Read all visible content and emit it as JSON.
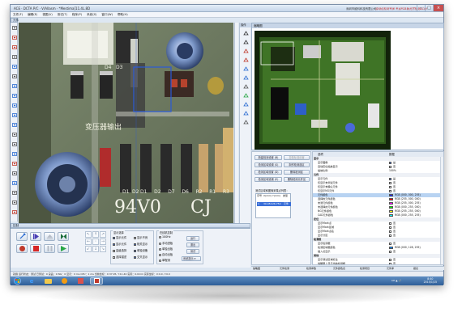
{
  "window": {
    "title": "ACE · DCTA P/C · V/Allasm · *Mestima]11.4L.8D",
    "company": "深圳市维科科技有限公司",
    "slogan": "自动化检测专家 专业PCB板光学检测ACOI"
  },
  "menu": [
    "文件(F)",
    "编辑(E)",
    "视图(V)",
    "测试(T)",
    "程序(P)",
    "系统(S)",
    "窗口(W)",
    "帮助(H)"
  ],
  "panels": {
    "left_toolbar_title": "元件",
    "camera_title": "",
    "ops_title": "操作",
    "thumbnail_title": "缩略图",
    "control_title": "控制"
  },
  "left_tools": [
    "select-tool",
    "rect-tool",
    "cross-tool",
    "measure-tool",
    "component-tool",
    "resistor-tool",
    "chip-tool",
    "ic-tool",
    "gear-tool",
    "gear2-tool",
    "capacitor-tool",
    "diode-tool",
    "transistor-tool",
    "connector-tool",
    "led-tool",
    "bga-tool",
    "zoom-tool",
    "pin-tool",
    "move-tool",
    "delete-tool"
  ],
  "ops_tools": [
    "arrow",
    "hand",
    "box",
    "box2",
    "draw",
    "pen",
    "chart",
    "scan",
    "zoom-in",
    "zoom-out",
    "settings"
  ],
  "camera_silk": {
    "diodes": [
      "D1",
      "D2",
      "D7",
      "D6",
      "R2",
      "R1",
      "R3"
    ],
    "top_labels": [
      "D4",
      "D3"
    ],
    "bottom_labels": [
      "D1",
      "D2"
    ],
    "big_text": "94V0",
    "big_text2": "CJ",
    "chinese": "变压器输出"
  },
  "mid_buttons": {
    "new_area": "新建检测设置 (B)",
    "area_copy": "复制标准设置",
    "save_area": "检测区域设置 (S)",
    "copy_area": "制作检测选区",
    "edit_area": "检测区域设置 (D)",
    "del_area": "删除检测区",
    "batch_edit": "检测区域设置 (E)",
    "batch_del": "删除检测元件区"
  },
  "table": {
    "title": "测试区域和图像采集点列表：",
    "headers": [
      "序号",
      "X(mm)",
      "Y(mm)",
      "类型"
    ],
    "rows": [
      [
        "1",
        "30.450",
        "26.750",
        "元件"
      ]
    ]
  },
  "props": {
    "col1": "选项",
    "col2": "数据",
    "rows": [
      {
        "k": "显示",
        "v": "",
        "cat": true
      },
      {
        "k": "显示图像",
        "v": "是",
        "check": true
      },
      {
        "k": "自动定位缩放显示",
        "v": "否",
        "check": false
      },
      {
        "k": "缩放比例",
        "v": "100%"
      },
      {
        "k": "元件",
        "v": "",
        "cat": true
      },
      {
        "k": "显示元件",
        "v": "是",
        "check": true
      },
      {
        "k": "仅显示未测试元件",
        "v": "否",
        "check": false
      },
      {
        "k": "仅显示未确认元件",
        "v": "否",
        "check": false
      },
      {
        "k": "仅显示NG元件",
        "v": "否",
        "check": false
      },
      {
        "k": "元件颜色",
        "v": "RGB (000, 000, 255)",
        "color": "#1a1aff"
      },
      {
        "k": "选择的元件颜色",
        "v": "RGB (255, 000, 000)",
        "color": "#ff0000"
      },
      {
        "k": "未测元件颜色",
        "v": "RGB (255, 000, 255)",
        "color": "#ff00ff"
      },
      {
        "k": "未选择的元件颜色",
        "v": "RGB (000, 255, 000)",
        "color": "#00ff00"
      },
      {
        "k": "NG元件颜色",
        "v": "RGB (255, 255, 000)",
        "color": "#ffff00"
      },
      {
        "k": "CAD元件颜色",
        "v": "RGB (000, 255, 255)",
        "color": "#00ffff"
      },
      {
        "k": "定位",
        "v": "",
        "cat": true
      },
      {
        "k": "显示Mark点",
        "v": "否",
        "check": false
      },
      {
        "k": "显示Mark区域",
        "v": "否",
        "check": false
      },
      {
        "k": "显示Mark点名",
        "v": "否",
        "check": false
      },
      {
        "k": "显示分区",
        "v": "否",
        "check": false
      },
      {
        "k": "检测框",
        "v": "",
        "cat": true
      },
      {
        "k": "显示检测框",
        "v": "否",
        "check": false
      },
      {
        "k": "检测区域框颜色",
        "v": "RGB (000, 128, 255)",
        "color": "#0080ff"
      },
      {
        "k": "插入点显示",
        "v": "否",
        "check": false
      },
      {
        "k": "其他",
        "v": "",
        "cat": true
      },
      {
        "k": "显示测试区域标注",
        "v": "否",
        "check": false
      },
      {
        "k": "缩略图上显示当前检测框",
        "v": "否",
        "check": false
      }
    ]
  },
  "controls": {
    "group1": "显示选择",
    "checks": [
      {
        "label": "显示元件",
        "on": true
      },
      {
        "label": "显示不良",
        "on": false
      },
      {
        "label": "显示元件",
        "on": true
      },
      {
        "label": "相关显示",
        "on": true
      },
      {
        "label": "高级选择",
        "on": false
      },
      {
        "label": "单独设备",
        "on": true
      },
      {
        "label": "选择描述",
        "on": false
      },
      {
        "label": "交叉显示",
        "on": true
      }
    ],
    "group2": "在线机控制",
    "radios": [
      "100Hz",
      "手动进板",
      "单独出板",
      "自动出板",
      "单程测"
    ],
    "btn_run": "运行",
    "btn_stop": "退出",
    "btn_home": "测试",
    "combo": "系统提示"
  },
  "status_strip": [
    "缩略图",
    "元件检测",
    "检测参数",
    "元件颜色表",
    "检测项目",
    "元件库",
    "报表"
  ],
  "statusbar": "就绪                                          运行状态：测试  已测试：0  良品：0  NG：0  显示：0 ms  CPU：1 ms  当前坐标：X:37.95, Y:11.40  实际：0.0mm  实际坐标：X:0.0, Y:0.0",
  "taskbar": {
    "tray": "CH ▲ 🔊",
    "time": "8:40",
    "date": "2015/1/15"
  }
}
